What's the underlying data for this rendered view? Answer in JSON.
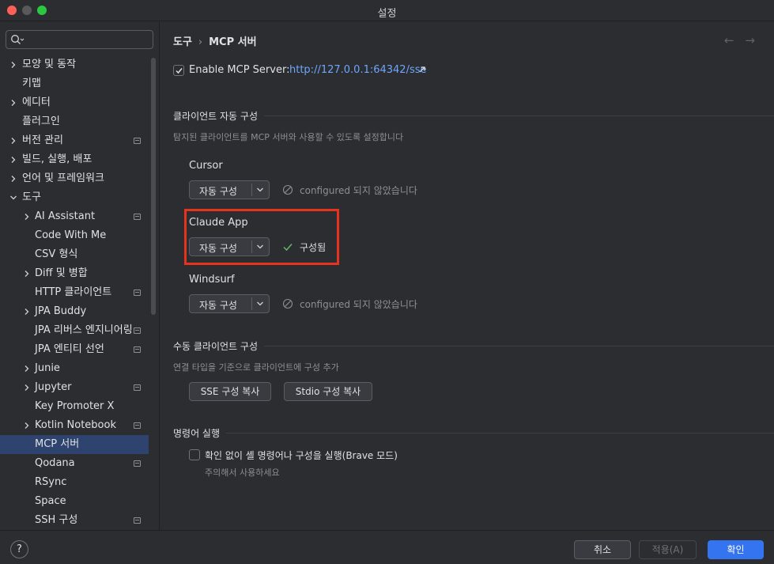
{
  "window": {
    "title": "설정"
  },
  "search": {
    "placeholder": ""
  },
  "sidebar": {
    "items": [
      {
        "label": "모양 및 동작",
        "level": 0,
        "chevron": "right",
        "pin": false
      },
      {
        "label": "키맵",
        "level": 0,
        "chevron": "none",
        "pin": false
      },
      {
        "label": "에디터",
        "level": 0,
        "chevron": "right",
        "pin": false
      },
      {
        "label": "플러그인",
        "level": 0,
        "chevron": "none",
        "pin": false
      },
      {
        "label": "버전 관리",
        "level": 0,
        "chevron": "right",
        "pin": true
      },
      {
        "label": "빌드, 실행, 배포",
        "level": 0,
        "chevron": "right",
        "pin": false
      },
      {
        "label": "언어 및 프레임워크",
        "level": 0,
        "chevron": "right",
        "pin": false
      },
      {
        "label": "도구",
        "level": 0,
        "chevron": "down",
        "pin": false
      },
      {
        "label": "AI Assistant",
        "level": 1,
        "chevron": "right",
        "pin": true
      },
      {
        "label": "Code With Me",
        "level": 1,
        "chevron": "none",
        "pin": false
      },
      {
        "label": "CSV 형식",
        "level": 1,
        "chevron": "none",
        "pin": false
      },
      {
        "label": "Diff 및 병합",
        "level": 1,
        "chevron": "right",
        "pin": false
      },
      {
        "label": "HTTP 클라이언트",
        "level": 1,
        "chevron": "none",
        "pin": true
      },
      {
        "label": "JPA Buddy",
        "level": 1,
        "chevron": "right",
        "pin": false
      },
      {
        "label": "JPA 리버스 엔지니어링",
        "level": 1,
        "chevron": "none",
        "pin": true
      },
      {
        "label": "JPA 엔티티 선언",
        "level": 1,
        "chevron": "none",
        "pin": true
      },
      {
        "label": "Junie",
        "level": 1,
        "chevron": "right",
        "pin": false
      },
      {
        "label": "Jupyter",
        "level": 1,
        "chevron": "right",
        "pin": true
      },
      {
        "label": "Key Promoter X",
        "level": 1,
        "chevron": "none",
        "pin": false
      },
      {
        "label": "Kotlin Notebook",
        "level": 1,
        "chevron": "right",
        "pin": true
      },
      {
        "label": "MCP 서버",
        "level": 1,
        "chevron": "none",
        "pin": false,
        "selected": true
      },
      {
        "label": "Qodana",
        "level": 1,
        "chevron": "none",
        "pin": true
      },
      {
        "label": "RSync",
        "level": 1,
        "chevron": "none",
        "pin": false
      },
      {
        "label": "Space",
        "level": 1,
        "chevron": "none",
        "pin": false
      },
      {
        "label": "SSH 구성",
        "level": 1,
        "chevron": "none",
        "pin": true
      }
    ]
  },
  "breadcrumb": {
    "parent": "도구",
    "separator": "›",
    "current": "MCP 서버"
  },
  "nav": {
    "back": "←",
    "forward": "→"
  },
  "enable": {
    "label": "Enable MCP Server:",
    "url": "http://127.0.0.1:64342/sse",
    "checked": true
  },
  "auto_config": {
    "title": "클라이언트 자동 구성",
    "description": "탐지된 클라이언트를 MCP 서버와 사용할 수 있도록 설정합니다",
    "clients": [
      {
        "name": "Cursor",
        "button": "자동 구성",
        "status": "configured 되지 않았습니다",
        "ok": false
      },
      {
        "name": "Claude App",
        "button": "자동 구성",
        "status": "구성됨",
        "ok": true
      },
      {
        "name": "Windsurf",
        "button": "자동 구성",
        "status": "configured 되지 않았습니다",
        "ok": false
      }
    ]
  },
  "manual_config": {
    "title": "수동 클라이언트 구성",
    "description": "연결 타입을 기준으로 클라이언트에 구성 추가",
    "sse_button": "SSE 구성 복사",
    "stdio_button": "Stdio 구성 복사"
  },
  "command_exec": {
    "title": "명령어 실행",
    "checkbox_label": "확인 없이 셸 명령어나 구성을 실행(Brave 모드)",
    "checked": false,
    "hint": "주의해서 사용하세요"
  },
  "footer": {
    "help": "?",
    "cancel": "취소",
    "apply": "적용(A)",
    "ok": "확인"
  },
  "colors": {
    "accent": "#3574f0",
    "link": "#6ea6fb",
    "highlight_box": "#e8321e",
    "success": "#5fb865"
  }
}
